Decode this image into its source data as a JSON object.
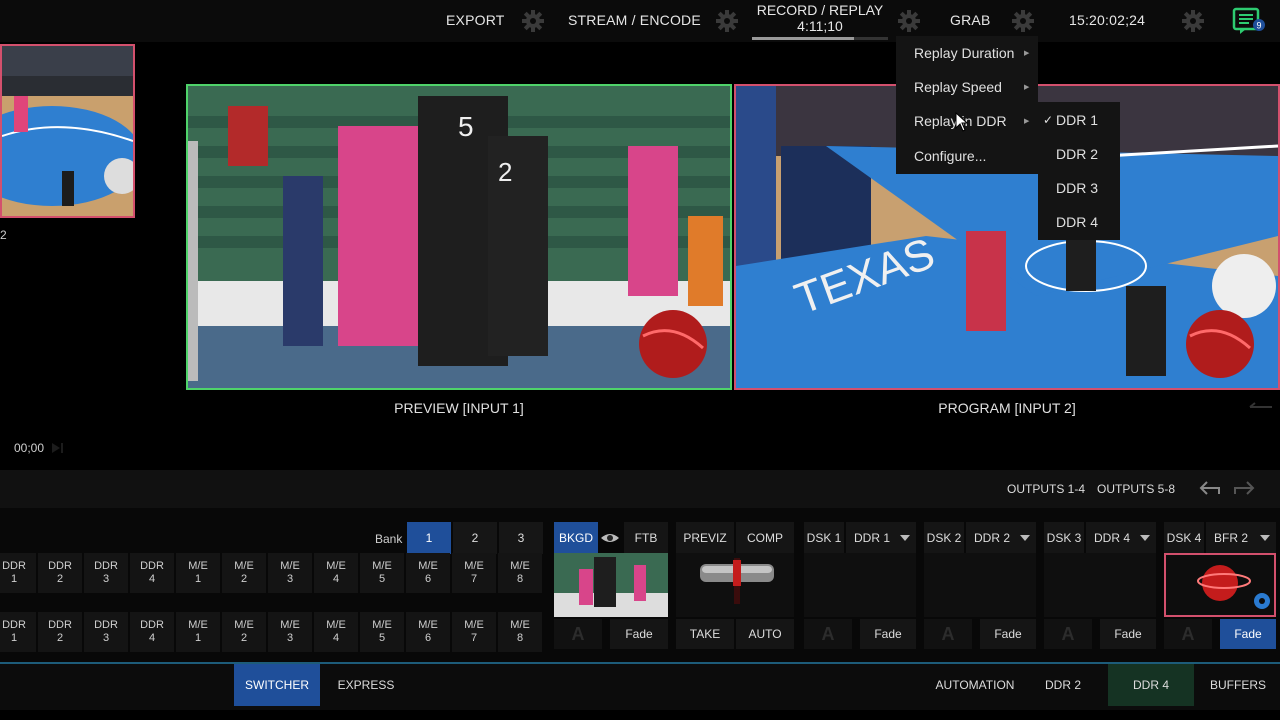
{
  "topbar": {
    "export_label": "EXPORT",
    "stream_label": "STREAM / ENCODE",
    "record_title": "RECORD / REPLAY",
    "record_time": "4:11;10",
    "record_progress": 0.75,
    "grab_label": "GRAB",
    "clock": "15:20:02;24",
    "notification_count": "9"
  },
  "panes": {
    "preview_label": "PREVIEW [INPUT 1]",
    "program_label": "PROGRAM [INPUT 2]",
    "left_number": "2",
    "left_time": "00;00"
  },
  "replay_menu": {
    "items": [
      "Replay Duration",
      "Replay Speed",
      "Replay in DDR",
      "Configure..."
    ],
    "ddr_options": [
      "DDR 1",
      "DDR 2",
      "DDR 3",
      "DDR 4"
    ],
    "checked": "✓"
  },
  "outputs": {
    "outputs_1_4": "OUTPUTS 1-4",
    "outputs_5_8": "OUTPUTS 5-8"
  },
  "switcher": {
    "bank_label": "Bank",
    "banks": [
      "1",
      "2",
      "3"
    ],
    "sources": [
      [
        "DDR",
        "1"
      ],
      [
        "DDR",
        "2"
      ],
      [
        "DDR",
        "3"
      ],
      [
        "DDR",
        "4"
      ],
      [
        "M/E",
        "1"
      ],
      [
        "M/E",
        "2"
      ],
      [
        "M/E",
        "3"
      ],
      [
        "M/E",
        "4"
      ],
      [
        "M/E",
        "5"
      ],
      [
        "M/E",
        "6"
      ],
      [
        "M/E",
        "7"
      ],
      [
        "M/E",
        "8"
      ]
    ],
    "bkgd": "BKGD",
    "ftb": "FTB",
    "previz": "PREVIZ",
    "comp": "COMP",
    "take": "TAKE",
    "auto": "AUTO",
    "dsk_groups": [
      {
        "dsk": "DSK 1",
        "source": "DDR 1"
      },
      {
        "dsk": "DSK 2",
        "source": "DDR 2"
      },
      {
        "dsk": "DSK 3",
        "source": "DDR 4"
      },
      {
        "dsk": "DSK 4",
        "source": "BFR 2"
      }
    ],
    "fade": "Fade",
    "a_glyph": "A"
  },
  "bottom_tabs": {
    "switcher": "SWITCHER",
    "express": "EXPRESS",
    "automation": "AUTOMATION",
    "ddr2": "DDR 2",
    "ddr4": "DDR 4",
    "buffers": "BUFFERS"
  },
  "colors": {
    "accent": "#1f4f9a",
    "preview_border": "#4fd36a",
    "program_border": "#d3506d",
    "notification": "#2ecc71"
  }
}
